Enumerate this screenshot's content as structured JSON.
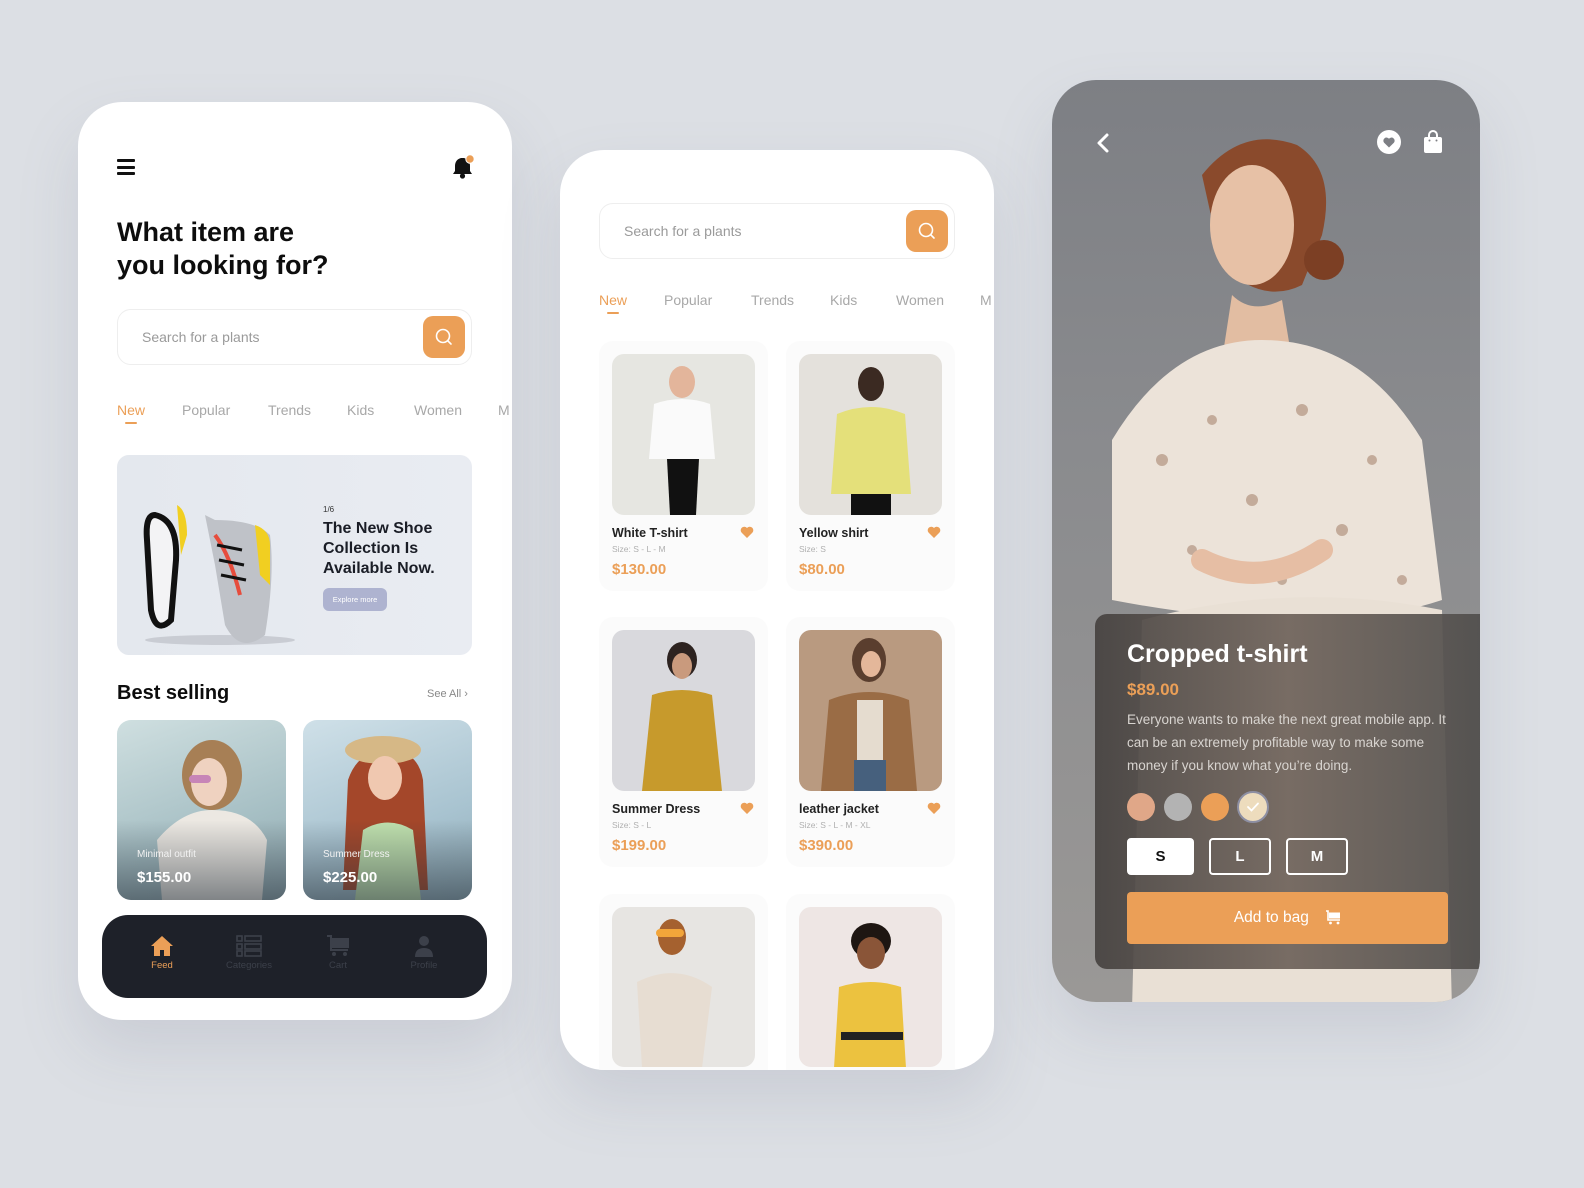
{
  "colors": {
    "accent": "#eb9f57",
    "navbar": "#1e2129",
    "background": "#dcdfe4"
  },
  "home": {
    "menu_icon": "hamburger-icon",
    "notification_icon": "bell-icon",
    "headline_line1": "What item are",
    "headline_line2": "you looking for?",
    "search": {
      "placeholder": "Search for a plants",
      "button_icon": "search-icon"
    },
    "tabs": [
      {
        "label": "New",
        "active": true
      },
      {
        "label": "Popular"
      },
      {
        "label": "Trends"
      },
      {
        "label": "Kids"
      },
      {
        "label": "Women"
      },
      {
        "label": "M"
      }
    ],
    "banner": {
      "counter": "1/6",
      "title": "The New Shoe Collection Is Available Now.",
      "button": "Explore more"
    },
    "best_selling": {
      "title": "Best selling",
      "see_all": "See All ›",
      "items": [
        {
          "caption": "Minimal outfit",
          "price": "$155.00"
        },
        {
          "caption": "Summer Dress",
          "price": "$225.00"
        }
      ]
    },
    "nav": [
      {
        "label": "Feed",
        "icon": "home-icon",
        "active": true
      },
      {
        "label": "Categories",
        "icon": "list-icon"
      },
      {
        "label": "Cart",
        "icon": "cart-icon"
      },
      {
        "label": "Profile",
        "icon": "user-icon"
      }
    ]
  },
  "catalog": {
    "search": {
      "placeholder": "Search for a plants"
    },
    "tabs": [
      {
        "label": "New",
        "active": true
      },
      {
        "label": "Popular"
      },
      {
        "label": "Trends"
      },
      {
        "label": "Kids"
      },
      {
        "label": "Women"
      },
      {
        "label": "M"
      }
    ],
    "products": [
      {
        "name": "White T-shirt",
        "size_label": "Size:",
        "sizes": "S - L - M",
        "price": "$130.00",
        "favorited": true
      },
      {
        "name": "Yellow shirt",
        "size_label": "Size:",
        "sizes": "S",
        "price": "$80.00",
        "favorited": true
      },
      {
        "name": "Summer Dress",
        "size_label": "Size:",
        "sizes": "S - L",
        "price": "$199.00",
        "favorited": true
      },
      {
        "name": "leather jacket",
        "size_label": "Size:",
        "sizes": "S - L - M - XL",
        "price": "$390.00",
        "favorited": true
      }
    ]
  },
  "detail": {
    "back_icon": "chevron-left-icon",
    "title": "Cropped t-shirt",
    "price": "$89.00",
    "description": "Everyone wants to make the next great mobile app. It can be an extremely profitable way to make some money if you know what you’re doing.",
    "swatches": [
      {
        "color": "#e0a788"
      },
      {
        "color": "#b3b3b3"
      },
      {
        "color": "#eb9f57"
      },
      {
        "color": "#eddcbd",
        "selected": true
      }
    ],
    "sizes": [
      {
        "label": "S",
        "selected": true
      },
      {
        "label": "L"
      },
      {
        "label": "M"
      }
    ],
    "add_button": "Add to bag"
  }
}
